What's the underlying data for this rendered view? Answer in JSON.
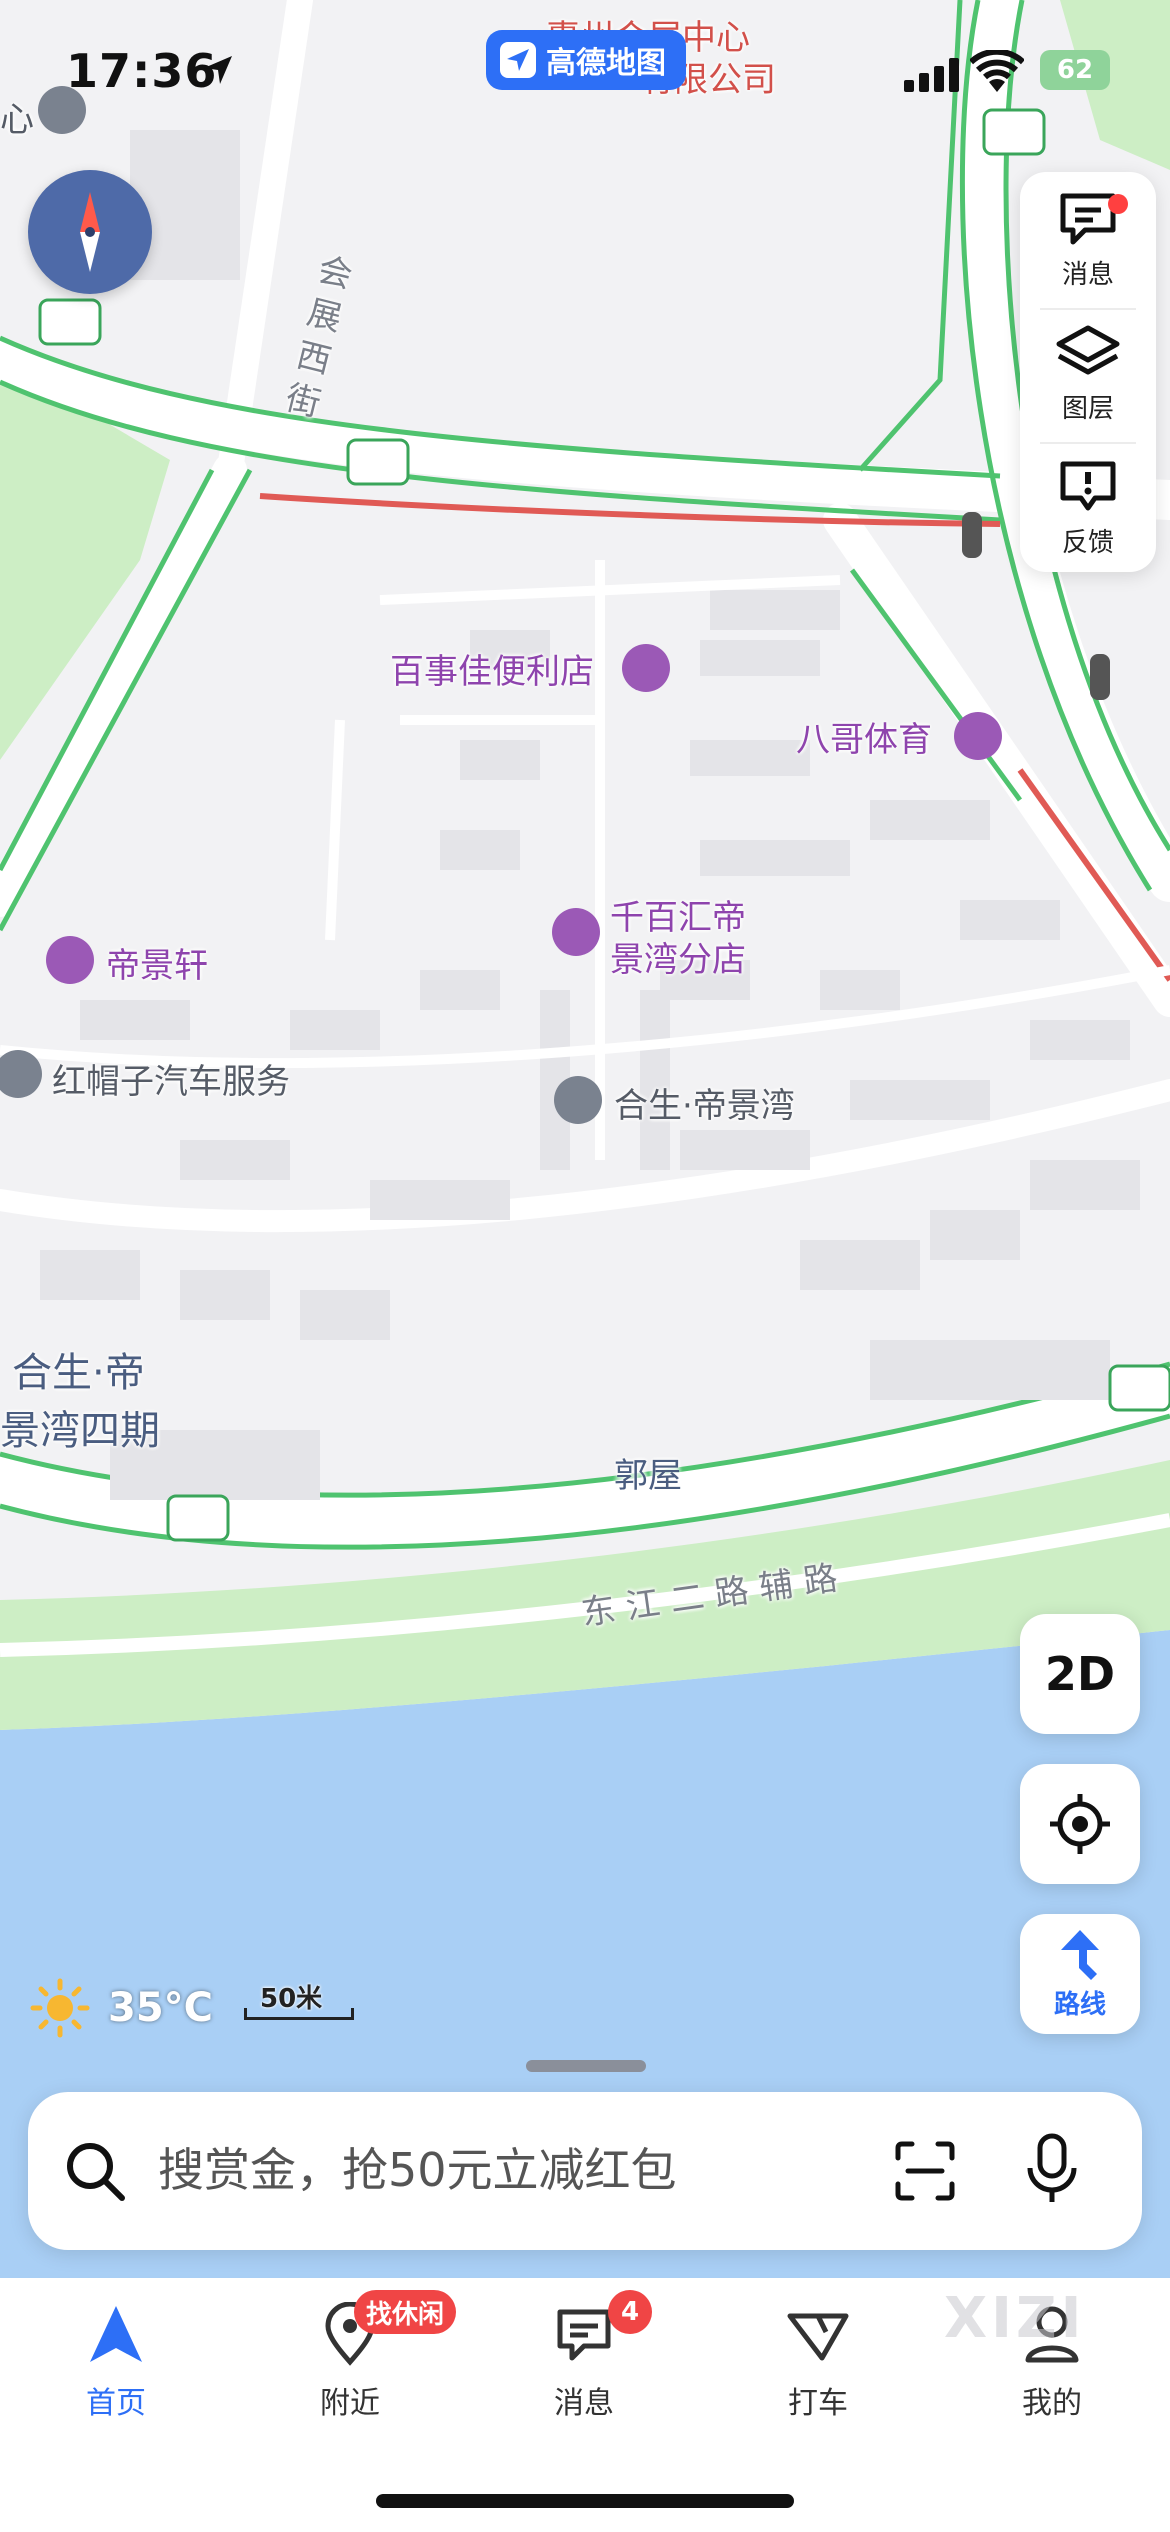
{
  "status_bar": {
    "time": "17:36",
    "battery": "62"
  },
  "app_badge": {
    "label": "高德地图"
  },
  "map": {
    "labels": {
      "top_poi_line1": "惠州会展中心",
      "top_poi_line2": "有限公司",
      "left_edge": "心",
      "road_huizhan": "会展西街",
      "poi_baishijia": "百事佳便利店",
      "poi_bage": "八哥体育",
      "poi_qianbaihui_1": "千百汇帝",
      "poi_qianbaihui_2": "景湾分店",
      "poi_dijingxuan": "帝景轩",
      "poi_hongmaozi": "红帽子汽车服务",
      "poi_hesheng": "合生·帝景湾",
      "area_hesheng4_1": "合生·帝",
      "area_hesheng4_2": "景湾四期",
      "area_guowu": "郭屋",
      "road_dongjiang": "东 江 二 路 辅 路"
    },
    "colors": {
      "road_congestion": "#e05a55",
      "road_smooth": "#4fc36f",
      "water": "#a9cff5",
      "park": "#cdeec5"
    }
  },
  "tools": {
    "message": "消息",
    "layers": "图层",
    "feedback": "反馈"
  },
  "buttons": {
    "mode": "2D",
    "route": "路线"
  },
  "weather": {
    "temp": "35°C",
    "icon": "sun-icon"
  },
  "scale": {
    "label": "50米"
  },
  "search": {
    "placeholder": "搜赏金，抢50元立减红包"
  },
  "tabs": [
    {
      "label": "首页",
      "icon": "home-nav-icon"
    },
    {
      "label": "附近",
      "icon": "location-pin-icon",
      "badge": "找休闲"
    },
    {
      "label": "消息",
      "icon": "message-icon",
      "badge": "4"
    },
    {
      "label": "打车",
      "icon": "taxi-icon"
    },
    {
      "label": "我的",
      "icon": "profile-icon"
    }
  ],
  "watermark": "XIZI"
}
